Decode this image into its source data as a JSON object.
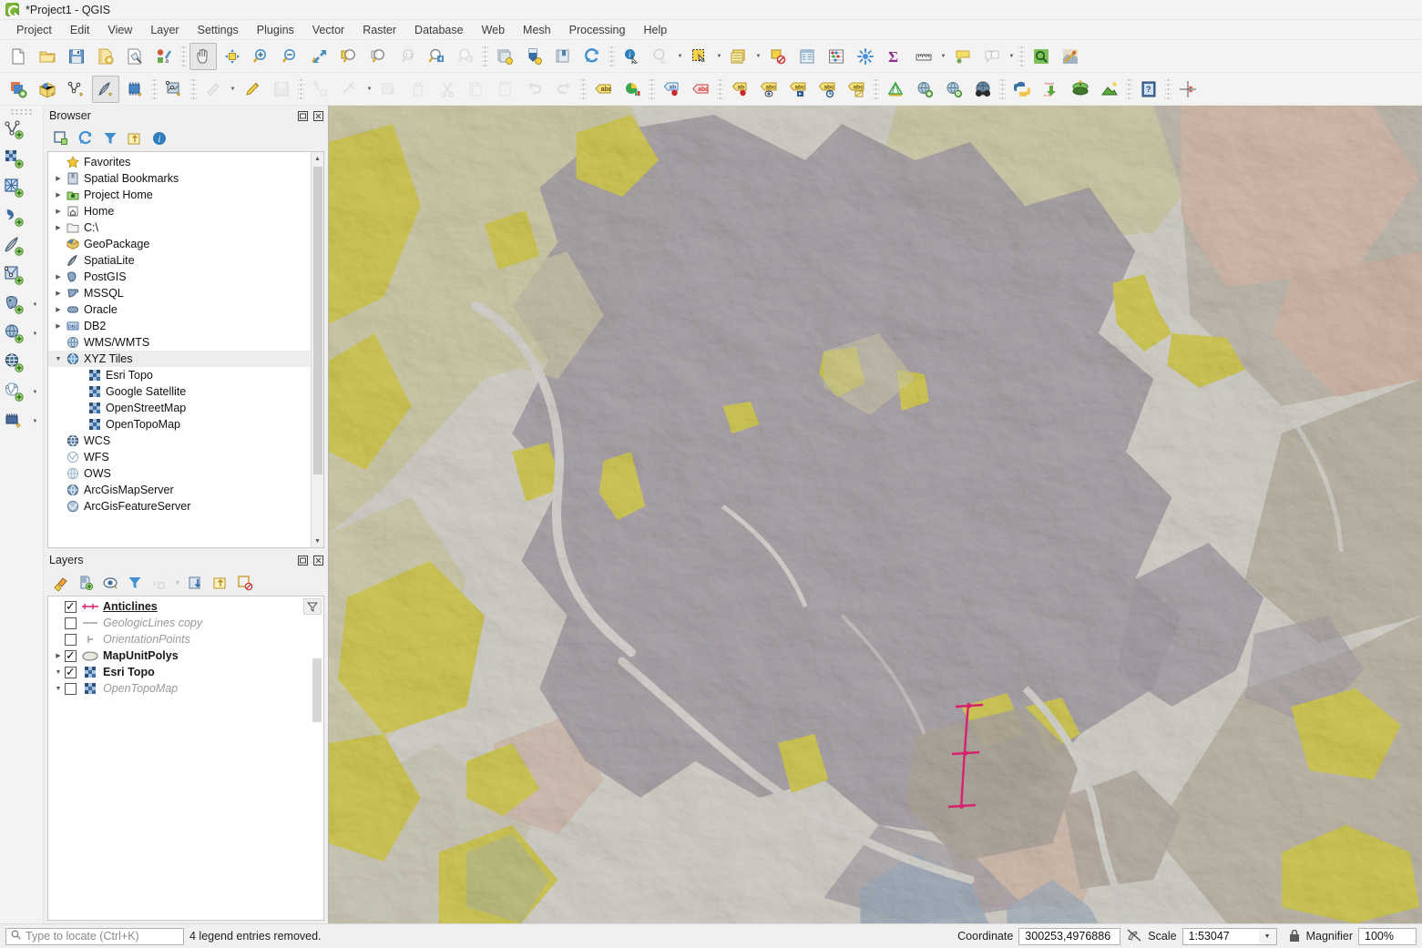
{
  "window": {
    "title": "*Project1 - QGIS",
    "logo_icon": "qgis-logo-icon"
  },
  "menubar": {
    "items": [
      {
        "label": "Project",
        "accel": "P"
      },
      {
        "label": "Edit",
        "accel": "E"
      },
      {
        "label": "View",
        "accel": "V"
      },
      {
        "label": "Layer",
        "accel": "L"
      },
      {
        "label": "Settings",
        "accel": "S"
      },
      {
        "label": "Plugins",
        "accel": "P"
      },
      {
        "label": "Vector",
        "accel": "o"
      },
      {
        "label": "Raster",
        "accel": "R"
      },
      {
        "label": "Database",
        "accel": "D"
      },
      {
        "label": "Web",
        "accel": "W"
      },
      {
        "label": "Mesh",
        "accel": "M"
      },
      {
        "label": "Processing",
        "accel": "c"
      },
      {
        "label": "Help",
        "accel": "H"
      }
    ]
  },
  "toolbar_main": {
    "items": [
      {
        "name": "new-project-icon",
        "label": "New Project"
      },
      {
        "name": "open-project-icon",
        "label": "Open Project"
      },
      {
        "name": "save-project-icon",
        "label": "Save Project"
      },
      {
        "name": "save-project-as-icon",
        "label": "Save Project As"
      },
      {
        "name": "new-print-layout-icon",
        "label": "New Print Layout"
      },
      {
        "name": "style-manager-icon",
        "label": "Style Manager"
      },
      {
        "name": "pan-map-icon",
        "label": "Pan Map"
      },
      {
        "name": "pan-to-selection-icon",
        "label": "Pan Map to Selection"
      },
      {
        "name": "zoom-in-icon",
        "label": "Zoom In"
      },
      {
        "name": "zoom-out-icon",
        "label": "Zoom Out"
      },
      {
        "name": "zoom-full-icon",
        "label": "Zoom Full"
      },
      {
        "name": "zoom-to-selection-icon",
        "label": "Zoom to Selection"
      },
      {
        "name": "zoom-to-layer-icon",
        "label": "Zoom to Layer"
      },
      {
        "name": "zoom-native-icon",
        "label": "Zoom to Native Resolution"
      },
      {
        "name": "zoom-last-icon",
        "label": "Zoom Last"
      },
      {
        "name": "zoom-next-icon",
        "label": "Zoom Next"
      },
      {
        "name": "new-map-view-icon",
        "label": "New Map View"
      },
      {
        "name": "new-3d-map-view-icon",
        "label": "New 3D Map View"
      },
      {
        "name": "show-bookmarks-icon",
        "label": "Show Bookmarks"
      },
      {
        "name": "refresh-icon",
        "label": "Refresh"
      },
      {
        "name": "identify-features-icon",
        "label": "Identify Features"
      },
      {
        "name": "run-feature-action-icon",
        "label": "Run Feature Action"
      },
      {
        "name": "select-features-icon",
        "label": "Select Features by Area"
      },
      {
        "name": "open-attribute-table-icon",
        "label": "Open Attribute Table"
      },
      {
        "name": "deselect-features-icon",
        "label": "Deselect Features"
      },
      {
        "name": "field-calculator-icon",
        "label": "Field Calculator"
      },
      {
        "name": "statistical-summary-icon",
        "label": "Statistical Summary"
      },
      {
        "name": "processing-toolbox-icon",
        "label": "Processing Toolbox"
      },
      {
        "name": "sum-icon",
        "label": "Sum"
      },
      {
        "name": "measure-line-icon",
        "label": "Measure Line"
      },
      {
        "name": "map-tips-icon",
        "label": "Show Map Tips"
      },
      {
        "name": "text-annotation-icon",
        "label": "Text Annotation"
      },
      {
        "name": "find-icon",
        "label": "Find"
      },
      {
        "name": "layout-manager-icon",
        "label": "Layout Manager"
      }
    ]
  },
  "toolbar_digitize": {
    "items": [
      {
        "name": "add-layer-icon",
        "label": "Open Data Source Manager"
      },
      {
        "name": "open-geopackage-icon",
        "label": "Open GeoPackage"
      },
      {
        "name": "new-shapefile-layer-icon",
        "label": "New Shapefile Layer"
      },
      {
        "name": "new-spatialite-layer-icon",
        "label": "New SpatiaLite Layer"
      },
      {
        "name": "new-memory-layer-icon",
        "label": "New Temporary Scratch Layer"
      },
      {
        "name": "new-gpkg-layer-icon",
        "label": "New GeoPackage Layer"
      },
      {
        "name": "current-edits-icon",
        "label": "Current Edits"
      },
      {
        "name": "toggle-editing-icon",
        "label": "Toggle Editing"
      },
      {
        "name": "save-layer-edits-icon",
        "label": "Save Layer Edits"
      },
      {
        "name": "add-feature-icon",
        "label": "Add Feature"
      },
      {
        "name": "vertex-tool-icon",
        "label": "Vertex Tool"
      },
      {
        "name": "modify-attributes-icon",
        "label": "Modify Attributes of Features"
      },
      {
        "name": "delete-selected-icon",
        "label": "Delete Selected"
      },
      {
        "name": "cut-features-icon",
        "label": "Cut Features"
      },
      {
        "name": "copy-features-icon",
        "label": "Copy Features"
      },
      {
        "name": "paste-features-icon",
        "label": "Paste Features"
      },
      {
        "name": "undo-icon",
        "label": "Undo"
      },
      {
        "name": "redo-icon",
        "label": "Redo"
      },
      {
        "name": "label-icon",
        "label": "Layer Labeling Options"
      },
      {
        "name": "diagram-icon",
        "label": "Layer Diagram Options"
      },
      {
        "name": "pin-labels-icon",
        "label": "Pin/Unpin Labels"
      },
      {
        "name": "highlight-labels-icon",
        "label": "Highlight Pinned Labels"
      },
      {
        "name": "move-label-icon",
        "label": "Move Label"
      },
      {
        "name": "show-hide-labels-icon",
        "label": "Show/Hide Labels"
      },
      {
        "name": "rotate-label-icon",
        "label": "Rotate Label"
      },
      {
        "name": "change-label-icon",
        "label": "Change Label"
      },
      {
        "name": "label-properties-icon",
        "label": "Label Properties"
      },
      {
        "name": "mesh-digitizing-icon",
        "label": "Mesh Digitizing"
      },
      {
        "name": "metasearch-add-icon",
        "label": "MetaSearch"
      },
      {
        "name": "metasearch-find-icon",
        "label": "MetaSearch Find"
      },
      {
        "name": "binoculars-icon",
        "label": "Search"
      },
      {
        "name": "python-console-icon",
        "label": "Python Console"
      },
      {
        "name": "plugin-builder-icon",
        "label": "Plugin Builder"
      },
      {
        "name": "qgis2web-icon",
        "label": "qgis2web"
      },
      {
        "name": "terrain-icon",
        "label": "Terrain Tools"
      },
      {
        "name": "help-icon",
        "label": "Help"
      },
      {
        "name": "georeferencer-icon",
        "label": "Georeferencer"
      }
    ]
  },
  "toolbar_left_vertical": {
    "items": [
      {
        "name": "add-vector-layer-icon",
        "label": "Add Vector Layer",
        "has_arrow": false
      },
      {
        "name": "add-raster-layer-icon",
        "label": "Add Raster Layer",
        "has_arrow": false
      },
      {
        "name": "add-mesh-layer-icon",
        "label": "Add Mesh Layer",
        "has_arrow": false
      },
      {
        "name": "add-delimited-text-layer-icon",
        "label": "Add Delimited Text Layer",
        "has_arrow": false
      },
      {
        "name": "add-spatialite-layer-icon",
        "label": "Add SpatiaLite Layer",
        "has_arrow": false
      },
      {
        "name": "add-vector-tile-layer-icon",
        "label": "Add Vector Tile Layer",
        "has_arrow": false
      },
      {
        "name": "add-postgis-layer-icon",
        "label": "Add PostGIS Layer",
        "has_arrow": true
      },
      {
        "name": "add-wms-layer-icon",
        "label": "Add WMS/WMTS Layer",
        "has_arrow": true
      },
      {
        "name": "add-wcs-layer-icon",
        "label": "Add WCS Layer",
        "has_arrow": false
      },
      {
        "name": "add-wfs-layer-icon",
        "label": "Add WFS Layer",
        "has_arrow": true
      },
      {
        "name": "add-arcgis-layer-icon",
        "label": "Add ArcGIS Layer",
        "has_arrow": true
      }
    ]
  },
  "browser_panel": {
    "title": "Browser",
    "float_icon": "float-panel-icon",
    "close_icon": "close-panel-icon",
    "toolbar": [
      {
        "name": "add-layer-selected-icon",
        "label": "Add Selected Layers"
      },
      {
        "name": "refresh-browser-icon",
        "label": "Refresh"
      },
      {
        "name": "filter-browser-icon",
        "label": "Filter Browser"
      },
      {
        "name": "collapse-all-icon",
        "label": "Collapse All"
      },
      {
        "name": "enable-properties-icon",
        "label": "Enable/Disable Properties Widget"
      }
    ],
    "tree": [
      {
        "label": "Favorites",
        "icon": "star-icon",
        "indent": 1,
        "expander": "none",
        "selected": false
      },
      {
        "label": "Spatial Bookmarks",
        "icon": "bookmark-icon",
        "indent": 1,
        "expander": "collapsed",
        "selected": false
      },
      {
        "label": "Project Home",
        "icon": "project-home-icon",
        "indent": 1,
        "expander": "collapsed",
        "selected": false
      },
      {
        "label": "Home",
        "icon": "home-icon",
        "indent": 1,
        "expander": "collapsed",
        "selected": false
      },
      {
        "label": "C:\\",
        "icon": "folder-icon",
        "indent": 1,
        "expander": "collapsed",
        "selected": false
      },
      {
        "label": "GeoPackage",
        "icon": "geopackage-icon",
        "indent": 1,
        "expander": "none",
        "selected": false
      },
      {
        "label": "SpatiaLite",
        "icon": "spatialite-icon",
        "indent": 1,
        "expander": "none",
        "selected": false
      },
      {
        "label": "PostGIS",
        "icon": "postgis-icon",
        "indent": 1,
        "expander": "collapsed",
        "selected": false
      },
      {
        "label": "MSSQL",
        "icon": "mssql-icon",
        "indent": 1,
        "expander": "collapsed",
        "selected": false
      },
      {
        "label": "Oracle",
        "icon": "oracle-icon",
        "indent": 1,
        "expander": "collapsed",
        "selected": false
      },
      {
        "label": "DB2",
        "icon": "db2-icon",
        "indent": 1,
        "expander": "collapsed",
        "selected": false
      },
      {
        "label": "WMS/WMTS",
        "icon": "wms-icon",
        "indent": 1,
        "expander": "none",
        "selected": false
      },
      {
        "label": "XYZ Tiles",
        "icon": "xyz-tiles-icon",
        "indent": 1,
        "expander": "expanded",
        "selected": true
      },
      {
        "label": "Esri Topo",
        "icon": "tile-layer-icon",
        "indent": 2,
        "expander": "none",
        "selected": false
      },
      {
        "label": "Google Satellite",
        "icon": "tile-layer-icon",
        "indent": 2,
        "expander": "none",
        "selected": false
      },
      {
        "label": "OpenStreetMap",
        "icon": "tile-layer-icon",
        "indent": 2,
        "expander": "none",
        "selected": false
      },
      {
        "label": "OpenTopoMap",
        "icon": "tile-layer-icon",
        "indent": 2,
        "expander": "none",
        "selected": false
      },
      {
        "label": "WCS",
        "icon": "wcs-icon",
        "indent": 1,
        "expander": "none",
        "selected": false
      },
      {
        "label": "WFS",
        "icon": "wfs-icon",
        "indent": 1,
        "expander": "none",
        "selected": false
      },
      {
        "label": "OWS",
        "icon": "ows-icon",
        "indent": 1,
        "expander": "none",
        "selected": false
      },
      {
        "label": "ArcGisMapServer",
        "icon": "arcgis-map-icon",
        "indent": 1,
        "expander": "none",
        "selected": false
      },
      {
        "label": "ArcGisFeatureServer",
        "icon": "arcgis-feature-icon",
        "indent": 1,
        "expander": "none",
        "selected": false
      }
    ]
  },
  "layers_panel": {
    "title": "Layers",
    "float_icon": "float-panel-icon",
    "close_icon": "close-panel-icon",
    "toolbar": [
      {
        "name": "open-layer-styling-icon",
        "label": "Open the Layer Styling panel",
        "disabled": false
      },
      {
        "name": "add-group-icon",
        "label": "Add Group",
        "disabled": false
      },
      {
        "name": "manage-map-themes-icon",
        "label": "Manage Map Themes",
        "disabled": false
      },
      {
        "name": "filter-legend-icon",
        "label": "Filter Legend",
        "disabled": false
      },
      {
        "name": "filter-legend-expression-icon",
        "label": "Filter Legend by Expression",
        "disabled": true
      },
      {
        "name": "expand-all-icon",
        "label": "Expand All",
        "disabled": false
      },
      {
        "name": "collapse-all-layers-icon",
        "label": "Collapse All",
        "disabled": false
      },
      {
        "name": "remove-layer-icon",
        "label": "Remove Layer/Group",
        "disabled": false
      }
    ],
    "filter_icon": "legend-filter-icon",
    "layers": [
      {
        "label": "Anticlines",
        "checked": true,
        "style": "bold-underline",
        "symbol": "line-anticline-symbol",
        "expander": "none"
      },
      {
        "label": "GeologicLines copy",
        "checked": false,
        "style": "italic-off",
        "symbol": "line-plain-symbol",
        "expander": "none"
      },
      {
        "label": "OrientationPoints",
        "checked": false,
        "style": "italic-off",
        "symbol": "point-tick-symbol",
        "expander": "none"
      },
      {
        "label": "MapUnitPolys",
        "checked": true,
        "style": "bold",
        "symbol": "polygon-symbol",
        "expander": "collapsed"
      },
      {
        "label": "Esri Topo",
        "checked": true,
        "style": "bold",
        "symbol": "tile-layer-icon",
        "expander": "expanded"
      },
      {
        "label": "OpenTopoMap",
        "checked": false,
        "style": "italic-off",
        "symbol": "tile-layer-icon",
        "expander": "expanded"
      }
    ]
  },
  "map": {
    "name": "map-canvas",
    "description": "Geologic map with hillshade relief over Esri Topo basemap showing MapUnitPolys polygons and an Anticlines fold line",
    "colors": {
      "purple_unit": "#a89ba8",
      "yellow_unit": "#f2e41c",
      "pale_yellow_unit": "#efe6a8",
      "peach_unit": "#f6cdb0",
      "tan_unit": "#cbbfa8",
      "brown_unit": "#b9a894",
      "blue_unit": "#9fb6cf",
      "cream_background": "#f7f2e4",
      "anticline_pink": "#d6216e"
    }
  },
  "statusbar": {
    "locate_placeholder": "Type to locate (Ctrl+K)",
    "search_icon": "search-icon",
    "message": "4 legend entries removed.",
    "coordinate_label": "Coordinate",
    "coordinate_value": "300253,4976886",
    "toggle_extents_icon": "toggle-extents-icon",
    "scale_label": "Scale",
    "scale_value": "1:53047",
    "scale_dropdown_icon": "chevron-down-icon",
    "lock_icon": "lock-scale-icon",
    "magnifier_label": "Magnifier",
    "magnifier_value": "100%"
  }
}
